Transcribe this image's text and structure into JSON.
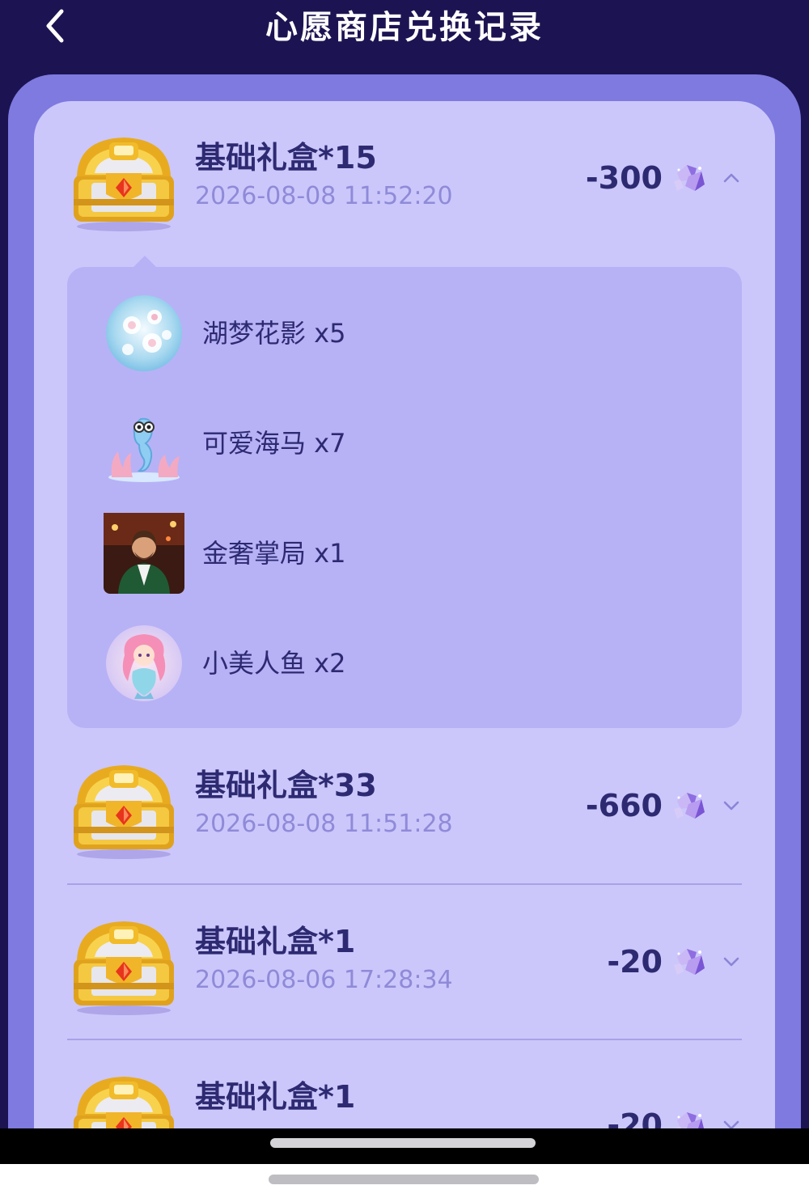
{
  "header": {
    "title": "心愿商店兑换记录"
  },
  "records": [
    {
      "name": "基础礼盒*15",
      "time": "2026-08-08 11:52:20",
      "price": "-300",
      "expanded": true,
      "items": [
        {
          "label": "湖梦花影 x5",
          "icon": "flower-bubble-icon"
        },
        {
          "label": "可爱海马 x7",
          "icon": "seahorse-icon"
        },
        {
          "label": "金奢掌局 x1",
          "icon": "tuxedo-man-icon"
        },
        {
          "label": "小美人鱼 x2",
          "icon": "mermaid-icon"
        }
      ]
    },
    {
      "name": "基础礼盒*33",
      "time": "2026-08-08 11:51:28",
      "price": "-660",
      "expanded": false
    },
    {
      "name": "基础礼盒*1",
      "time": "2026-08-06 17:28:34",
      "price": "-20",
      "expanded": false
    },
    {
      "name": "基础礼盒*1",
      "time": "",
      "price": "-20",
      "expanded": false
    }
  ],
  "colors": {
    "header_bg": "#1c1452",
    "outer_panel": "#7e7ae0",
    "inner_panel": "#cbc7fb",
    "detail_bg": "#b7b2f6",
    "text_primary": "#2e2a72",
    "text_time": "#8f8ad8"
  }
}
